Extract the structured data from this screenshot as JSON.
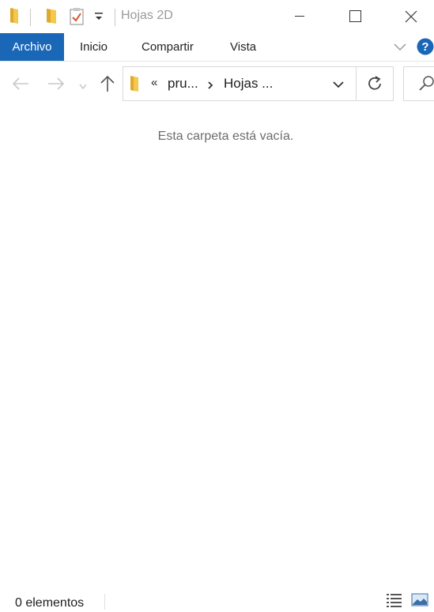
{
  "window": {
    "title": "Hojas 2D"
  },
  "ribbon": {
    "tabs": [
      {
        "label": "Archivo"
      },
      {
        "label": "Inicio"
      },
      {
        "label": "Compartir"
      },
      {
        "label": "Vista"
      }
    ]
  },
  "address": {
    "overflow": "«",
    "crumbs": [
      "pru...",
      "Hojas ..."
    ]
  },
  "content": {
    "empty_message": "Esta carpeta está vacía."
  },
  "status": {
    "count": "0 elementos"
  },
  "colors": {
    "accent": "#1a67b8",
    "folder": "#f2c94c",
    "help": "#1a67b8"
  },
  "icons": [
    "folder-icon",
    "properties-icon",
    "dropdown-icon",
    "minimize-icon",
    "maximize-icon",
    "close-icon",
    "expand-ribbon-icon",
    "help-icon",
    "back-icon",
    "forward-icon",
    "recent-icon",
    "up-icon",
    "chevron-down-icon",
    "refresh-icon",
    "search-icon",
    "details-view-icon",
    "large-icons-view-icon"
  ]
}
